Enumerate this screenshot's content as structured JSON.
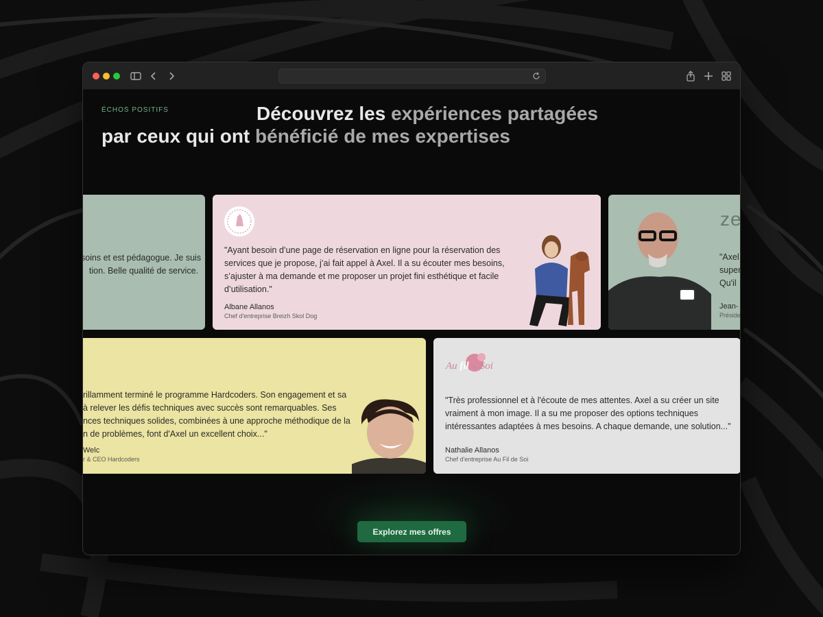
{
  "colors": {
    "accent_green": "#1f6a40",
    "eyebrow_green": "#76b48a",
    "card_sage": "#a9bdb1",
    "card_pink": "#eed8de",
    "card_yellow": "#ebe4a2",
    "card_grey": "#e3e3e3"
  },
  "browser": {
    "icons": [
      "sidebar-icon",
      "back-icon",
      "forward-icon",
      "reload-icon",
      "share-icon",
      "new-tab-icon",
      "tab-overview-icon"
    ]
  },
  "section": {
    "eyebrow": "ÉCHOS POSITIFS",
    "headline_part1": "Découvrez les ",
    "headline_part2": "expériences partagées",
    "headline_part3": " par ceux qui ont ",
    "headline_part4": "bénéficié de mes expertises"
  },
  "testimonials": {
    "sage_left": {
      "quote_line1": "esoins et est pédagogue. Je suis",
      "quote_line2": "tion. Belle qualité de service."
    },
    "pink": {
      "logo_alt": "Breizh Skol Dog logo",
      "quote": "\"Ayant besoin d’une page de réservation en ligne pour la réservation des services que je propose, j’ai fait appel à Axel. Il a su écouter mes besoins, s’ajuster à ma demande et me proposer un projet fini esthétique et facile d’utilisation.\"",
      "author": "Albane Allanos",
      "role": "Chef d'entreprise Breizh Skol Dog"
    },
    "sage_right": {
      "logo_text": "ze",
      "quote_line1": "\"Axel",
      "quote_line2": "super",
      "quote_line3": "Qu'il",
      "author": "Jean-",
      "role": "Préside"
    },
    "yellow": {
      "quote_line1": "rillamment terminé le programme Hardcoders. Son engagement et sa",
      "quote_line2": "à relever les défis techniques avec succès sont remarquables. Ses",
      "quote_line3": "nces techniques solides, combinées à une approche méthodique de la",
      "quote_line4": "n de problèmes, font d'Axel un excellent choix...\"",
      "author": "Welc",
      "role": "r & CEO Hardcoders"
    },
    "grey": {
      "logo_text_1": "Au",
      "logo_text_2": "fil",
      "logo_text_3": "de",
      "logo_text_4": "Soi",
      "quote": "\"Très professionnel et à l'écoute de mes attentes. Axel a su créer un site vraiment à mon image. Il a su me proposer des options techniques intéressantes adaptées à mes besoins.  A chaque demande, une solution...\"",
      "author": "Nathalie Allanos",
      "role": "Chef d'entreprise Au Fil de Soi"
    }
  },
  "cta": {
    "label": "Explorez mes offres"
  }
}
